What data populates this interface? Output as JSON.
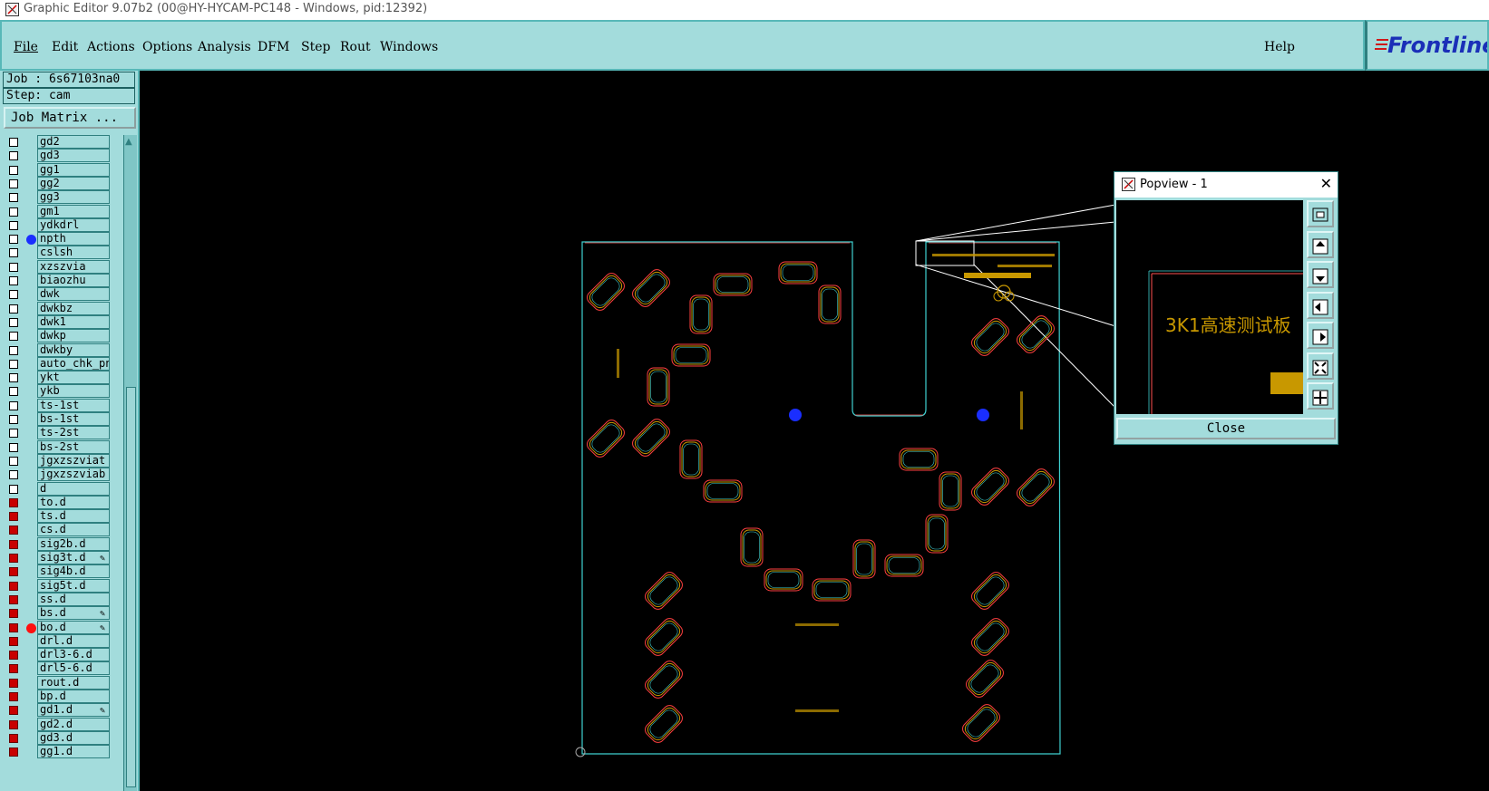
{
  "window": {
    "title": "Graphic Editor 9.07b2 (00@HY-HYCAM-PC148 - Windows, pid:12392)"
  },
  "menu": {
    "items": [
      {
        "label": "File"
      },
      {
        "label": "Edit"
      },
      {
        "label": "Actions"
      },
      {
        "label": "Options"
      },
      {
        "label": "Analysis"
      },
      {
        "label": "DFM"
      },
      {
        "label": "Step"
      },
      {
        "label": "Rout"
      },
      {
        "label": "Windows"
      }
    ],
    "help": "Help"
  },
  "logo": {
    "text": "Frontline"
  },
  "job": {
    "job_label": "Job : 6s67103na0",
    "step_label": "Step: cam",
    "matrix_button": "Job Matrix ..."
  },
  "layers": [
    {
      "name": "gd2",
      "checked": false
    },
    {
      "name": "gd3",
      "checked": false
    },
    {
      "name": "gg1",
      "checked": false
    },
    {
      "name": "gg2",
      "checked": false
    },
    {
      "name": "gg3",
      "checked": false
    },
    {
      "name": "gm1",
      "checked": false
    },
    {
      "name": "ydkdrl",
      "checked": false
    },
    {
      "name": "npth",
      "checked": false,
      "dot": "#1a2eff"
    },
    {
      "name": "cslsh",
      "checked": false
    },
    {
      "name": "xzszvia",
      "checked": false
    },
    {
      "name": "biaozhu",
      "checked": false
    },
    {
      "name": "dwk",
      "checked": false
    },
    {
      "name": "dwkbz",
      "checked": false
    },
    {
      "name": "dwk1",
      "checked": false
    },
    {
      "name": "dwkp",
      "checked": false
    },
    {
      "name": "dwkby",
      "checked": false
    },
    {
      "name": "auto_chk_pnl",
      "checked": false
    },
    {
      "name": "ykt",
      "checked": false
    },
    {
      "name": "ykb",
      "checked": false
    },
    {
      "name": "ts-1st",
      "checked": false
    },
    {
      "name": "bs-1st",
      "checked": false
    },
    {
      "name": "ts-2st",
      "checked": false
    },
    {
      "name": "bs-2st",
      "checked": false
    },
    {
      "name": "jgxzszviat",
      "checked": false
    },
    {
      "name": "jgxzszviab",
      "checked": false
    },
    {
      "name": "d",
      "checked": false
    },
    {
      "name": "to.d",
      "checked": true
    },
    {
      "name": "ts.d",
      "checked": true
    },
    {
      "name": "cs.d",
      "checked": true
    },
    {
      "name": "sig2b.d",
      "checked": true
    },
    {
      "name": "sig3t.d",
      "checked": true,
      "edit": true
    },
    {
      "name": "sig4b.d",
      "checked": true
    },
    {
      "name": "sig5t.d",
      "checked": true
    },
    {
      "name": "ss.d",
      "checked": true
    },
    {
      "name": "bs.d",
      "checked": true,
      "edit": true
    },
    {
      "name": "bo.d",
      "checked": true,
      "edit": true,
      "dot": "#ff1010"
    },
    {
      "name": "drl.d",
      "checked": true
    },
    {
      "name": "drl3-6.d",
      "checked": true
    },
    {
      "name": "drl5-6.d",
      "checked": true
    },
    {
      "name": "rout.d",
      "checked": true
    },
    {
      "name": "bp.d",
      "checked": true
    },
    {
      "name": "gd1.d",
      "checked": true,
      "edit": true
    },
    {
      "name": "gd2.d",
      "checked": true
    },
    {
      "name": "gd3.d",
      "checked": true
    },
    {
      "name": "gg1.d",
      "checked": true
    }
  ],
  "popview": {
    "title": "Popview - 1",
    "close_label": "Close",
    "zoom_text": "3K1高速测试板",
    "buttons": [
      "fit-icon",
      "pan-up-icon",
      "pan-down-icon",
      "pan-left-icon",
      "pan-right-icon",
      "zoom-out-icon",
      "zoom-in-icon"
    ]
  },
  "colors": {
    "panel": "#a3dcdc",
    "profile": "#3fd0d0",
    "copper": "#c89800",
    "pad_outline": "#ff4040",
    "hole": "#1a2eff"
  }
}
